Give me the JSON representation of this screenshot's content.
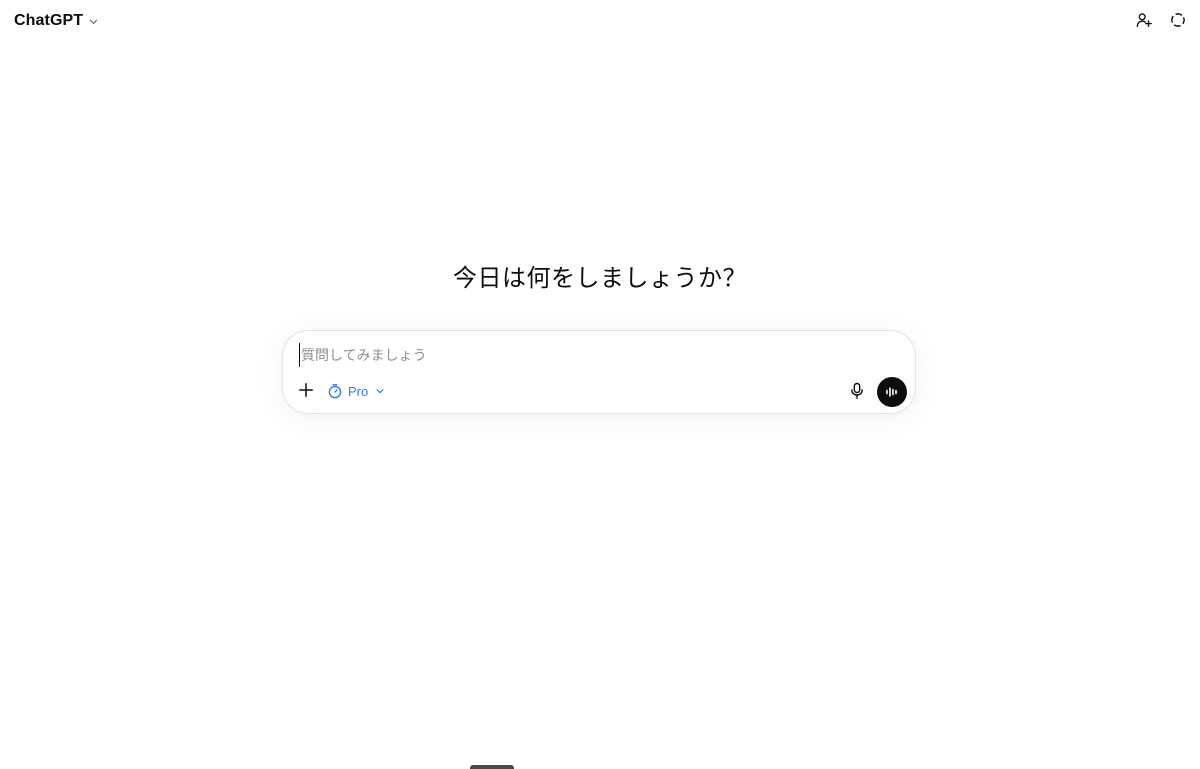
{
  "header": {
    "model_name": "ChatGPT",
    "icons": {
      "model_chevron": "chevron-down-icon",
      "share": "add-person-icon",
      "temporary_chat": "dashed-circle-icon"
    }
  },
  "main": {
    "headline": "今日は何をしましょうか？",
    "composer": {
      "placeholder": "質問してみましょう",
      "value": "",
      "mode_label": "Pro",
      "icons": {
        "add": "plus-icon",
        "mode": "timer-icon",
        "mode_chevron": "chevron-down-icon",
        "mic": "microphone-icon",
        "voice": "voice-waveform-icon"
      }
    }
  },
  "colors": {
    "accent": "#2f7de1",
    "text": "#0d0d0d",
    "placeholder": "#8f8f8f",
    "voice_button": "#0d0d0d",
    "border": "#e3e3e3"
  }
}
